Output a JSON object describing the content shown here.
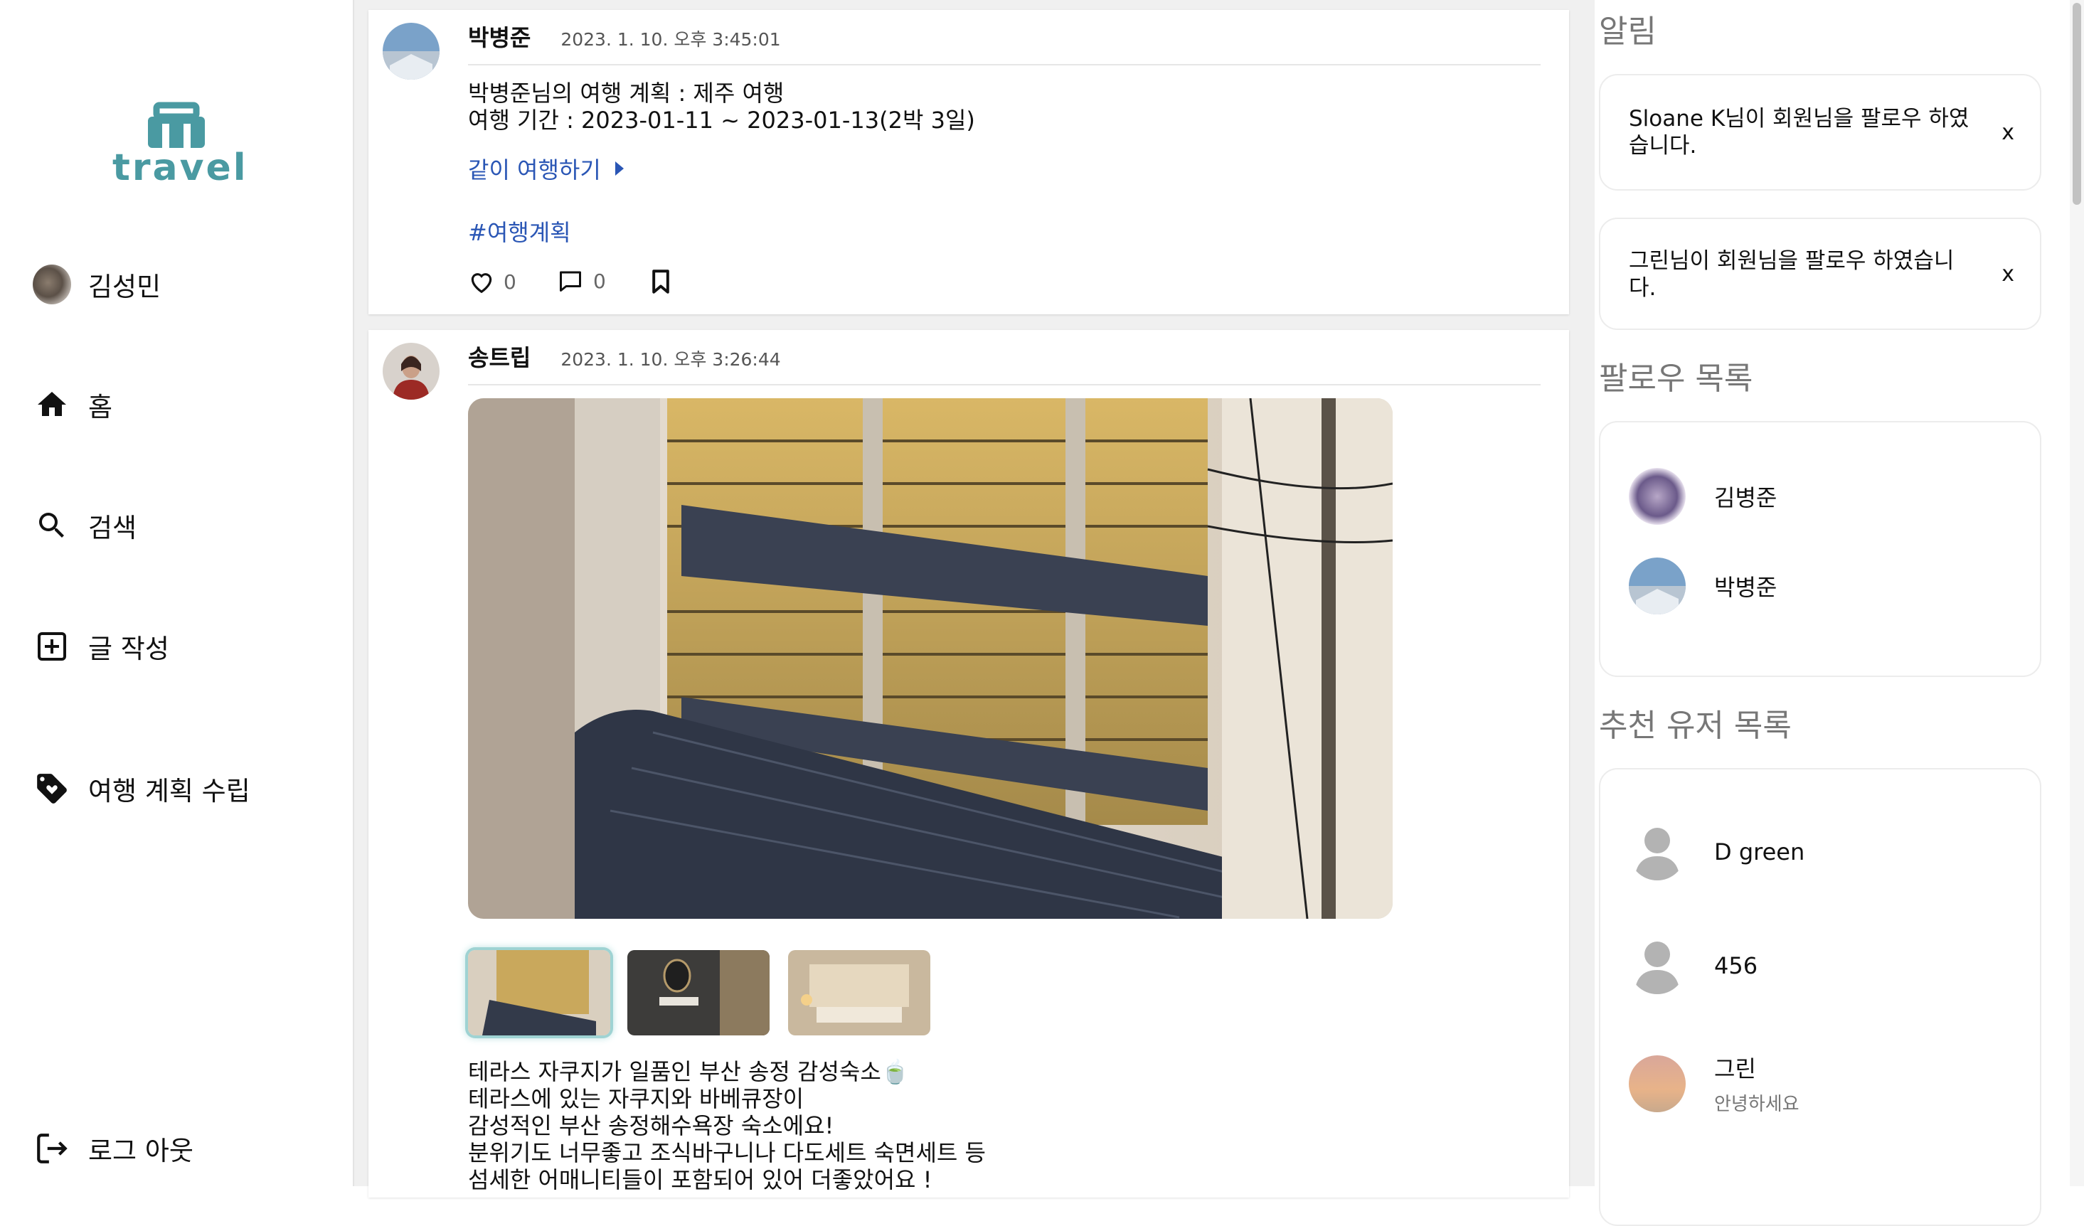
{
  "app": {
    "logo_text": "travel"
  },
  "sidebar": {
    "user_name": "김성민",
    "items": [
      {
        "label": "홈",
        "icon": "home-icon"
      },
      {
        "label": "검색",
        "icon": "search-icon"
      },
      {
        "label": "글 작성",
        "icon": "add-box-icon"
      },
      {
        "label": "여행 계획 수립",
        "icon": "tag-icon"
      }
    ],
    "logout_label": "로그 아웃"
  },
  "feed": {
    "posts": [
      {
        "author": "박병준",
        "date": "2023. 1. 10. 오후 3:45:01",
        "text": "박병준님의 여행 계획 : 제주 여행\n여행 기간 : 2023-01-11 ~ 2023-01-13(2박 3일)",
        "join_label": "같이 여행하기",
        "hashtag": "#여행계획",
        "likes": "0",
        "comments": "0"
      },
      {
        "author": "송트립",
        "date": "2023. 1. 10. 오후 3:26:44",
        "text": "테라스 자쿠지가 일품인 부산 송정 감성숙소🍵\n테라스에 있는 자쿠지와 바베큐장이\n감성적인 부산 송정해수욕장 숙소에요!\n분위기도 너무좋고 조식바구니나 다도세트 숙면세트 등\n섬세한 어매니티들이 포함되어 있어 더좋았어요 !"
      }
    ]
  },
  "right": {
    "notifications_title": "알림",
    "notifications": [
      {
        "text": "Sloane K님이 회원님을 팔로우 하였습니다.",
        "close": "x"
      },
      {
        "text": "그린님이 회원님을 팔로우 하였습니다.",
        "close": "x"
      }
    ],
    "follow_title": "팔로우 목록",
    "follows": [
      {
        "name": "김병준"
      },
      {
        "name": "박병준"
      }
    ],
    "recommend_title": "추천 유저 목록",
    "recommends": [
      {
        "name": "D green",
        "sub": ""
      },
      {
        "name": "456",
        "sub": ""
      },
      {
        "name": "그린",
        "sub": "안녕하세요"
      }
    ]
  },
  "colors": {
    "brand": "#4a9aa2",
    "link": "#2a56b5",
    "feed_bg": "#f0f0f0"
  }
}
